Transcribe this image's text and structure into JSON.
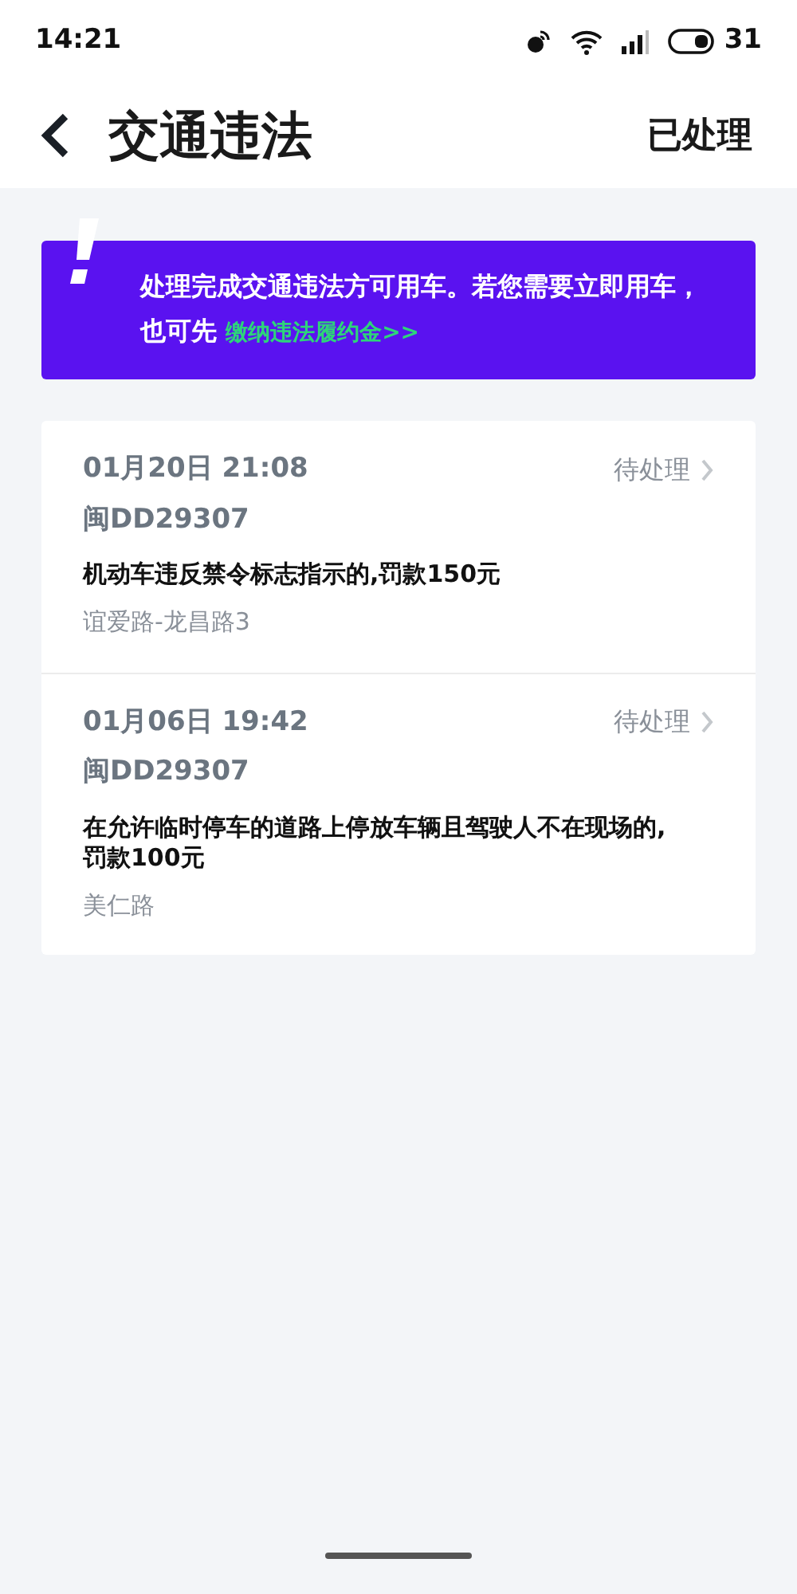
{
  "status_bar": {
    "time": "14:21",
    "battery": "31"
  },
  "header": {
    "title": "交通违法",
    "action": "已处理"
  },
  "notice": {
    "text": "处理完成交通违法方可用车。若您需要立即用车，也可先",
    "link": "缴纳违法履约金>>"
  },
  "violations": [
    {
      "datetime": "01月20日 21:08",
      "status": "待处理",
      "plate": "闽DD29307",
      "description": "机动车违反禁令标志指示的,罚款150元",
      "location": "谊爱路-龙昌路3"
    },
    {
      "datetime": "01月06日 19:42",
      "status": "待处理",
      "plate": "闽DD29307",
      "description": "在允许临时停车的道路上停放车辆且驾驶人不在现场的,罚款100元",
      "location": "美仁路"
    }
  ]
}
